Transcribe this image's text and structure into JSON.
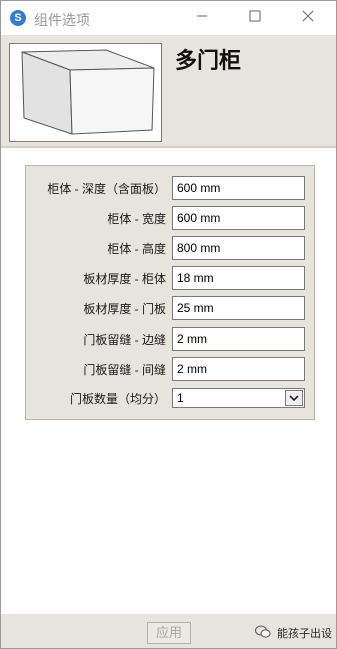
{
  "window": {
    "title": "组件选项",
    "app_icon": "sketchup-icon"
  },
  "header": {
    "component_name": "多门柜"
  },
  "options": [
    {
      "label": "柜体 - 深度（含面板）",
      "value": "600 mm"
    },
    {
      "label": "柜体 - 宽度",
      "value": "600 mm"
    },
    {
      "label": "柜体 - 高度",
      "value": "800 mm"
    },
    {
      "label": "板材厚度 - 柜体",
      "value": "18 mm"
    },
    {
      "label": "板材厚度 - 门板",
      "value": "25 mm"
    },
    {
      "label": "门板留缝 - 边缝",
      "value": "2 mm"
    },
    {
      "label": "门板留缝 - 间缝",
      "value": "2 mm"
    }
  ],
  "door_count": {
    "label": "门板数量（均分）",
    "selected": "1"
  },
  "footer": {
    "apply_label": "应用",
    "watermark": "能孩子出设"
  },
  "colors": {
    "panel_bg": "#e7e4de",
    "accent": "#2f7fd1"
  }
}
